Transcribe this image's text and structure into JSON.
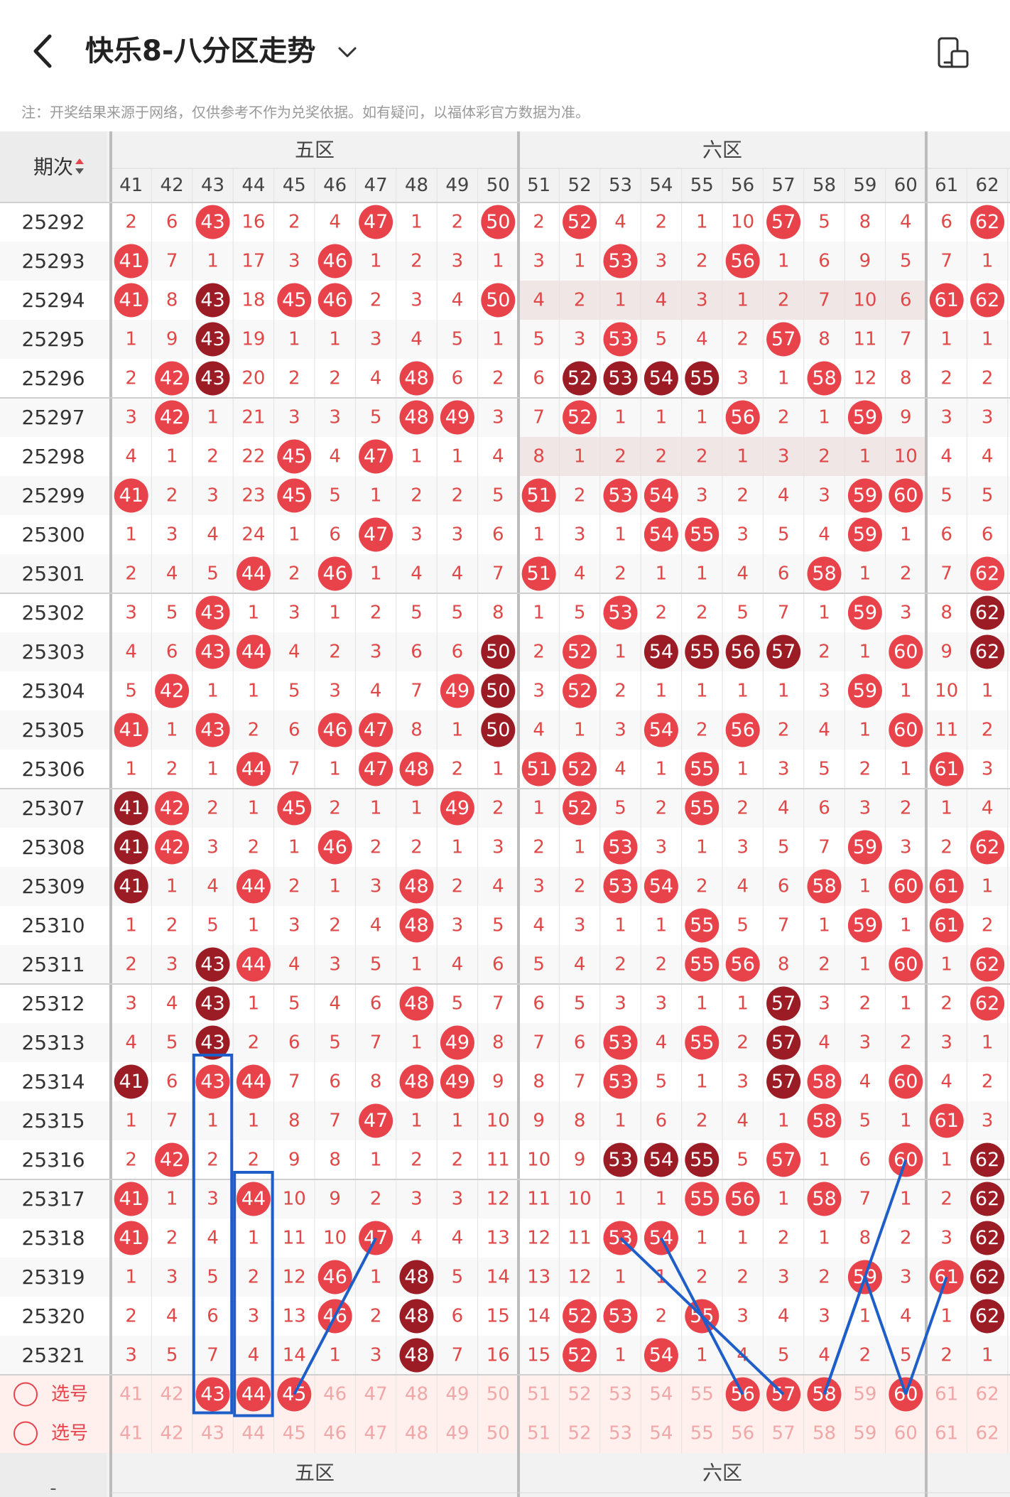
{
  "header": {
    "title": "快乐8-八分区走势"
  },
  "note": "注：开奖结果来源于网络，仅供参考不作为兑奖依据。如有疑问，以福体彩官方数据为准。",
  "table": {
    "period_header": "期次",
    "zone5_label": "五区",
    "zone6_label": "六区",
    "columns": [
      41,
      42,
      43,
      44,
      45,
      46,
      47,
      48,
      49,
      50,
      51,
      52,
      53,
      54,
      55,
      56,
      57,
      58,
      59,
      60,
      61,
      62
    ],
    "rows": [
      {
        "period": "25292",
        "cells": [
          "2",
          "6",
          "43",
          "16",
          "2",
          "4",
          "47",
          "1",
          "2",
          "50",
          "2",
          "52",
          "4",
          "2",
          "1",
          "10",
          "57",
          "5",
          "8",
          "4",
          "6",
          "62"
        ]
      },
      {
        "period": "25293",
        "cells": [
          "41",
          "7",
          "1",
          "17",
          "3",
          "46",
          "1",
          "2",
          "3",
          "1",
          "3",
          "1",
          "53",
          "3",
          "2",
          "56",
          "1",
          "6",
          "9",
          "5",
          "7",
          "1"
        ]
      },
      {
        "period": "25294",
        "cells": [
          "41",
          "8",
          "43",
          "18",
          "45",
          "46",
          "2",
          "3",
          "4",
          "50",
          "4",
          "2",
          "1",
          "4",
          "3",
          "1",
          "2",
          "7",
          "10",
          "6",
          "61",
          "62"
        ]
      },
      {
        "period": "25295",
        "cells": [
          "1",
          "9",
          "43",
          "19",
          "1",
          "1",
          "3",
          "4",
          "5",
          "1",
          "5",
          "3",
          "53",
          "5",
          "4",
          "2",
          "57",
          "8",
          "11",
          "7",
          "1",
          "1"
        ]
      },
      {
        "period": "25296",
        "cells": [
          "2",
          "42",
          "43",
          "20",
          "2",
          "2",
          "4",
          "48",
          "6",
          "2",
          "6",
          "52",
          "53",
          "54",
          "55",
          "3",
          "1",
          "58",
          "12",
          "8",
          "2",
          "2"
        ]
      },
      {
        "period": "25297",
        "cells": [
          "3",
          "42",
          "1",
          "21",
          "3",
          "3",
          "5",
          "48",
          "49",
          "3",
          "7",
          "52",
          "1",
          "1",
          "1",
          "56",
          "2",
          "1",
          "59",
          "9",
          "3",
          "3"
        ]
      },
      {
        "period": "25298",
        "cells": [
          "4",
          "1",
          "2",
          "22",
          "45",
          "4",
          "47",
          "1",
          "1",
          "4",
          "8",
          "1",
          "2",
          "2",
          "2",
          "1",
          "3",
          "2",
          "1",
          "10",
          "4",
          "4"
        ]
      },
      {
        "period": "25299",
        "cells": [
          "41",
          "2",
          "3",
          "23",
          "45",
          "5",
          "1",
          "2",
          "2",
          "5",
          "51",
          "2",
          "53",
          "54",
          "3",
          "2",
          "4",
          "3",
          "59",
          "60",
          "5",
          "5"
        ]
      },
      {
        "period": "25300",
        "cells": [
          "1",
          "3",
          "4",
          "24",
          "1",
          "6",
          "47",
          "3",
          "3",
          "6",
          "1",
          "3",
          "1",
          "54",
          "55",
          "3",
          "5",
          "4",
          "59",
          "1",
          "6",
          "6"
        ]
      },
      {
        "period": "25301",
        "cells": [
          "2",
          "4",
          "5",
          "44",
          "2",
          "46",
          "1",
          "4",
          "4",
          "7",
          "51",
          "4",
          "2",
          "1",
          "1",
          "4",
          "6",
          "58",
          "1",
          "2",
          "7",
          "62"
        ]
      },
      {
        "period": "25302",
        "cells": [
          "3",
          "5",
          "43",
          "1",
          "3",
          "1",
          "2",
          "5",
          "5",
          "8",
          "1",
          "5",
          "53",
          "2",
          "2",
          "5",
          "7",
          "1",
          "59",
          "3",
          "8",
          "62"
        ]
      },
      {
        "period": "25303",
        "cells": [
          "4",
          "6",
          "43",
          "44",
          "4",
          "2",
          "3",
          "6",
          "6",
          "50",
          "2",
          "52",
          "1",
          "54",
          "55",
          "56",
          "57",
          "2",
          "1",
          "60",
          "9",
          "62"
        ]
      },
      {
        "period": "25304",
        "cells": [
          "5",
          "42",
          "1",
          "1",
          "5",
          "3",
          "4",
          "7",
          "49",
          "50",
          "3",
          "52",
          "2",
          "1",
          "1",
          "1",
          "1",
          "3",
          "59",
          "1",
          "10",
          "1"
        ]
      },
      {
        "period": "25305",
        "cells": [
          "41",
          "1",
          "43",
          "2",
          "6",
          "46",
          "47",
          "8",
          "1",
          "50",
          "4",
          "1",
          "3",
          "54",
          "2",
          "56",
          "2",
          "4",
          "1",
          "60",
          "11",
          "2"
        ]
      },
      {
        "period": "25306",
        "cells": [
          "1",
          "2",
          "1",
          "44",
          "7",
          "1",
          "47",
          "48",
          "2",
          "1",
          "51",
          "52",
          "4",
          "1",
          "55",
          "1",
          "3",
          "5",
          "2",
          "1",
          "61",
          "3"
        ]
      },
      {
        "period": "25307",
        "cells": [
          "41",
          "42",
          "2",
          "1",
          "45",
          "2",
          "1",
          "1",
          "49",
          "2",
          "1",
          "52",
          "5",
          "2",
          "55",
          "2",
          "4",
          "6",
          "3",
          "2",
          "1",
          "4"
        ]
      },
      {
        "period": "25308",
        "cells": [
          "41",
          "42",
          "3",
          "2",
          "1",
          "46",
          "2",
          "2",
          "1",
          "3",
          "2",
          "1",
          "53",
          "3",
          "1",
          "3",
          "5",
          "7",
          "59",
          "3",
          "2",
          "62"
        ]
      },
      {
        "period": "25309",
        "cells": [
          "41",
          "1",
          "4",
          "44",
          "2",
          "1",
          "3",
          "48",
          "2",
          "4",
          "3",
          "2",
          "53",
          "54",
          "2",
          "4",
          "6",
          "58",
          "1",
          "60",
          "61",
          "1"
        ]
      },
      {
        "period": "25310",
        "cells": [
          "1",
          "2",
          "5",
          "1",
          "3",
          "2",
          "4",
          "48",
          "3",
          "5",
          "4",
          "3",
          "1",
          "1",
          "55",
          "5",
          "7",
          "1",
          "59",
          "1",
          "61",
          "2"
        ]
      },
      {
        "period": "25311",
        "cells": [
          "2",
          "3",
          "43",
          "44",
          "4",
          "3",
          "5",
          "1",
          "4",
          "6",
          "5",
          "4",
          "2",
          "2",
          "55",
          "56",
          "8",
          "2",
          "1",
          "60",
          "1",
          "62"
        ]
      },
      {
        "period": "25312",
        "cells": [
          "3",
          "4",
          "43",
          "1",
          "5",
          "4",
          "6",
          "48",
          "5",
          "7",
          "6",
          "5",
          "3",
          "3",
          "1",
          "1",
          "57",
          "3",
          "2",
          "1",
          "2",
          "62"
        ]
      },
      {
        "period": "25313",
        "cells": [
          "4",
          "5",
          "43",
          "2",
          "6",
          "5",
          "7",
          "1",
          "49",
          "8",
          "7",
          "6",
          "53",
          "4",
          "55",
          "2",
          "57",
          "4",
          "3",
          "2",
          "3",
          "1"
        ]
      },
      {
        "period": "25314",
        "cells": [
          "41",
          "6",
          "43",
          "44",
          "7",
          "6",
          "8",
          "48",
          "49",
          "9",
          "8",
          "7",
          "53",
          "5",
          "1",
          "3",
          "57",
          "58",
          "4",
          "60",
          "4",
          "2"
        ]
      },
      {
        "period": "25315",
        "cells": [
          "1",
          "7",
          "1",
          "1",
          "8",
          "7",
          "47",
          "1",
          "1",
          "10",
          "9",
          "8",
          "1",
          "6",
          "2",
          "4",
          "1",
          "58",
          "5",
          "1",
          "61",
          "3"
        ]
      },
      {
        "period": "25316",
        "cells": [
          "2",
          "42",
          "2",
          "2",
          "9",
          "8",
          "1",
          "2",
          "2",
          "11",
          "10",
          "9",
          "53",
          "54",
          "55",
          "5",
          "57",
          "1",
          "6",
          "60",
          "1",
          "62"
        ]
      },
      {
        "period": "25317",
        "cells": [
          "41",
          "1",
          "3",
          "44",
          "10",
          "9",
          "2",
          "3",
          "3",
          "12",
          "11",
          "10",
          "1",
          "1",
          "55",
          "56",
          "1",
          "58",
          "7",
          "1",
          "2",
          "62"
        ]
      },
      {
        "period": "25318",
        "cells": [
          "41",
          "2",
          "4",
          "1",
          "11",
          "10",
          "47",
          "4",
          "4",
          "13",
          "12",
          "11",
          "53",
          "54",
          "1",
          "1",
          "2",
          "1",
          "8",
          "2",
          "3",
          "62"
        ]
      },
      {
        "period": "25319",
        "cells": [
          "1",
          "3",
          "5",
          "2",
          "12",
          "46",
          "1",
          "48",
          "5",
          "14",
          "13",
          "12",
          "1",
          "1",
          "2",
          "2",
          "3",
          "2",
          "59",
          "3",
          "61",
          "62"
        ]
      },
      {
        "period": "25320",
        "cells": [
          "2",
          "4",
          "6",
          "3",
          "13",
          "46",
          "2",
          "48",
          "6",
          "15",
          "14",
          "52",
          "53",
          "2",
          "55",
          "3",
          "4",
          "3",
          "1",
          "4",
          "1",
          "62"
        ]
      },
      {
        "period": "25321",
        "cells": [
          "3",
          "5",
          "7",
          "4",
          "14",
          "1",
          "3",
          "48",
          "7",
          "16",
          "15",
          "52",
          "1",
          "54",
          "1",
          "4",
          "5",
          "4",
          "2",
          "5",
          "2",
          "1"
        ]
      }
    ],
    "select_label": "选号",
    "select_rows": [
      {
        "label": "选号",
        "selected": [
          "43",
          "44",
          "45",
          "56",
          "57",
          "58",
          "60"
        ]
      },
      {
        "label": "选号",
        "selected": []
      }
    ],
    "dark_cells": [
      [
        "25294",
        "43"
      ],
      [
        "25295",
        "43"
      ],
      [
        "25296",
        "43"
      ],
      [
        "25296",
        "52"
      ],
      [
        "25296",
        "53"
      ],
      [
        "25296",
        "54"
      ],
      [
        "25296",
        "55"
      ],
      [
        "25303",
        "50"
      ],
      [
        "25303",
        "54"
      ],
      [
        "25303",
        "55"
      ],
      [
        "25303",
        "56"
      ],
      [
        "25303",
        "57"
      ],
      [
        "25302",
        "62"
      ],
      [
        "25303",
        "62"
      ],
      [
        "25304",
        "50"
      ],
      [
        "25305",
        "50"
      ],
      [
        "25307",
        "41"
      ],
      [
        "25308",
        "41"
      ],
      [
        "25309",
        "41"
      ],
      [
        "25311",
        "43"
      ],
      [
        "25312",
        "43"
      ],
      [
        "25313",
        "43"
      ],
      [
        "25314",
        "41"
      ],
      [
        "25312",
        "57"
      ],
      [
        "25313",
        "57"
      ],
      [
        "25314",
        "57"
      ],
      [
        "25316",
        "53"
      ],
      [
        "25316",
        "54"
      ],
      [
        "25316",
        "55"
      ],
      [
        "25316",
        "62"
      ],
      [
        "25317",
        "62"
      ],
      [
        "25318",
        "62"
      ],
      [
        "25319",
        "62"
      ],
      [
        "25320",
        "62"
      ],
      [
        "25319",
        "48"
      ],
      [
        "25320",
        "48"
      ],
      [
        "25321",
        "48"
      ]
    ],
    "colors": {
      "red": "#e8434b",
      "dark": "#9b1c24",
      "text": "#e04848",
      "zone_line": "#c8c8c8",
      "blue": "#1e5ec9",
      "select_bg": "#fff0ee"
    }
  }
}
